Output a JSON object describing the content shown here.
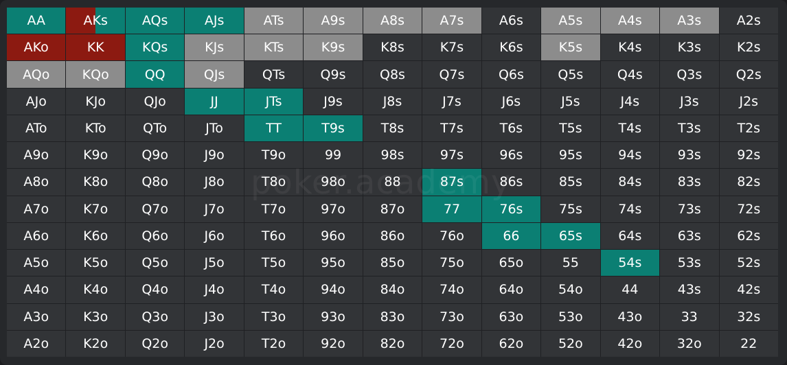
{
  "colors": {
    "raise": "#0b7f73",
    "allin": "#8c1a11",
    "call": "#8c8c8c",
    "fold": "#323437"
  },
  "watermark": "poker.academy",
  "grid": [
    [
      "AA",
      "AKs",
      "AQs",
      "AJs",
      "ATs",
      "A9s",
      "A8s",
      "A7s",
      "A6s",
      "A5s",
      "A4s",
      "A3s",
      "A2s"
    ],
    [
      "AKo",
      "KK",
      "KQs",
      "KJs",
      "KTs",
      "K9s",
      "K8s",
      "K7s",
      "K6s",
      "K5s",
      "K4s",
      "K3s",
      "K2s"
    ],
    [
      "AQo",
      "KQo",
      "QQ",
      "QJs",
      "QTs",
      "Q9s",
      "Q8s",
      "Q7s",
      "Q6s",
      "Q5s",
      "Q4s",
      "Q3s",
      "Q2s"
    ],
    [
      "AJo",
      "KJo",
      "QJo",
      "JJ",
      "JTs",
      "J9s",
      "J8s",
      "J7s",
      "J6s",
      "J5s",
      "J4s",
      "J3s",
      "J2s"
    ],
    [
      "ATo",
      "KTo",
      "QTo",
      "JTo",
      "TT",
      "T9s",
      "T8s",
      "T7s",
      "T6s",
      "T5s",
      "T4s",
      "T3s",
      "T2s"
    ],
    [
      "A9o",
      "K9o",
      "Q9o",
      "J9o",
      "T9o",
      "99",
      "98s",
      "97s",
      "96s",
      "95s",
      "94s",
      "93s",
      "92s"
    ],
    [
      "A8o",
      "K8o",
      "Q8o",
      "J8o",
      "T8o",
      "98o",
      "88",
      "87s",
      "86s",
      "85s",
      "84s",
      "83s",
      "82s"
    ],
    [
      "A7o",
      "K7o",
      "Q7o",
      "J7o",
      "T7o",
      "97o",
      "87o",
      "77",
      "76s",
      "75s",
      "74s",
      "73s",
      "72s"
    ],
    [
      "A6o",
      "K6o",
      "Q6o",
      "J6o",
      "T6o",
      "96o",
      "86o",
      "76o",
      "66",
      "65s",
      "64s",
      "63s",
      "62s"
    ],
    [
      "A5o",
      "K5o",
      "Q5o",
      "J5o",
      "T5o",
      "95o",
      "85o",
      "75o",
      "65o",
      "55",
      "54s",
      "53s",
      "52s"
    ],
    [
      "A4o",
      "K4o",
      "Q4o",
      "J4o",
      "T4o",
      "94o",
      "84o",
      "74o",
      "64o",
      "54o",
      "44",
      "43s",
      "42s"
    ],
    [
      "A3o",
      "K3o",
      "Q3o",
      "J3o",
      "T3o",
      "93o",
      "83o",
      "73o",
      "63o",
      "53o",
      "43o",
      "33",
      "32s"
    ],
    [
      "A2o",
      "K2o",
      "Q2o",
      "J2o",
      "T2o",
      "92o",
      "82o",
      "72o",
      "62o",
      "52o",
      "42o",
      "32o",
      "22"
    ]
  ],
  "actions": {
    "AA": [
      {
        "action": "raise",
        "fraction": 1
      }
    ],
    "AKs": [
      {
        "action": "allin",
        "fraction": 0.5
      },
      {
        "action": "raise",
        "fraction": 0.5
      }
    ],
    "AQs": [
      {
        "action": "raise",
        "fraction": 1
      }
    ],
    "AJs": [
      {
        "action": "raise",
        "fraction": 1
      }
    ],
    "ATs": [
      {
        "action": "call",
        "fraction": 1
      }
    ],
    "A9s": [
      {
        "action": "call",
        "fraction": 1
      }
    ],
    "A8s": [
      {
        "action": "call",
        "fraction": 1
      }
    ],
    "A7s": [
      {
        "action": "call",
        "fraction": 1
      }
    ],
    "A5s": [
      {
        "action": "call",
        "fraction": 1
      }
    ],
    "A4s": [
      {
        "action": "call",
        "fraction": 1
      }
    ],
    "A3s": [
      {
        "action": "call",
        "fraction": 1
      }
    ],
    "AKo": [
      {
        "action": "allin",
        "fraction": 1
      }
    ],
    "KK": [
      {
        "action": "allin",
        "fraction": 1
      }
    ],
    "KQs": [
      {
        "action": "raise",
        "fraction": 1
      }
    ],
    "KJs": [
      {
        "action": "call",
        "fraction": 1
      }
    ],
    "KTs": [
      {
        "action": "call",
        "fraction": 1
      }
    ],
    "K9s": [
      {
        "action": "call",
        "fraction": 1
      }
    ],
    "K5s": [
      {
        "action": "call",
        "fraction": 1
      }
    ],
    "AQo": [
      {
        "action": "call",
        "fraction": 1
      }
    ],
    "KQo": [
      {
        "action": "call",
        "fraction": 1
      }
    ],
    "QQ": [
      {
        "action": "raise",
        "fraction": 1
      }
    ],
    "QJs": [
      {
        "action": "call",
        "fraction": 1
      }
    ],
    "JJ": [
      {
        "action": "raise",
        "fraction": 1
      }
    ],
    "JTs": [
      {
        "action": "raise",
        "fraction": 1
      }
    ],
    "TT": [
      {
        "action": "raise",
        "fraction": 1
      }
    ],
    "T9s": [
      {
        "action": "raise",
        "fraction": 1
      }
    ],
    "87s": [
      {
        "action": "raise",
        "fraction": 1
      }
    ],
    "77": [
      {
        "action": "raise",
        "fraction": 1
      }
    ],
    "76s": [
      {
        "action": "raise",
        "fraction": 1
      }
    ],
    "66": [
      {
        "action": "raise",
        "fraction": 1
      }
    ],
    "65s": [
      {
        "action": "raise",
        "fraction": 1
      }
    ],
    "54s": [
      {
        "action": "raise",
        "fraction": 1
      }
    ]
  }
}
